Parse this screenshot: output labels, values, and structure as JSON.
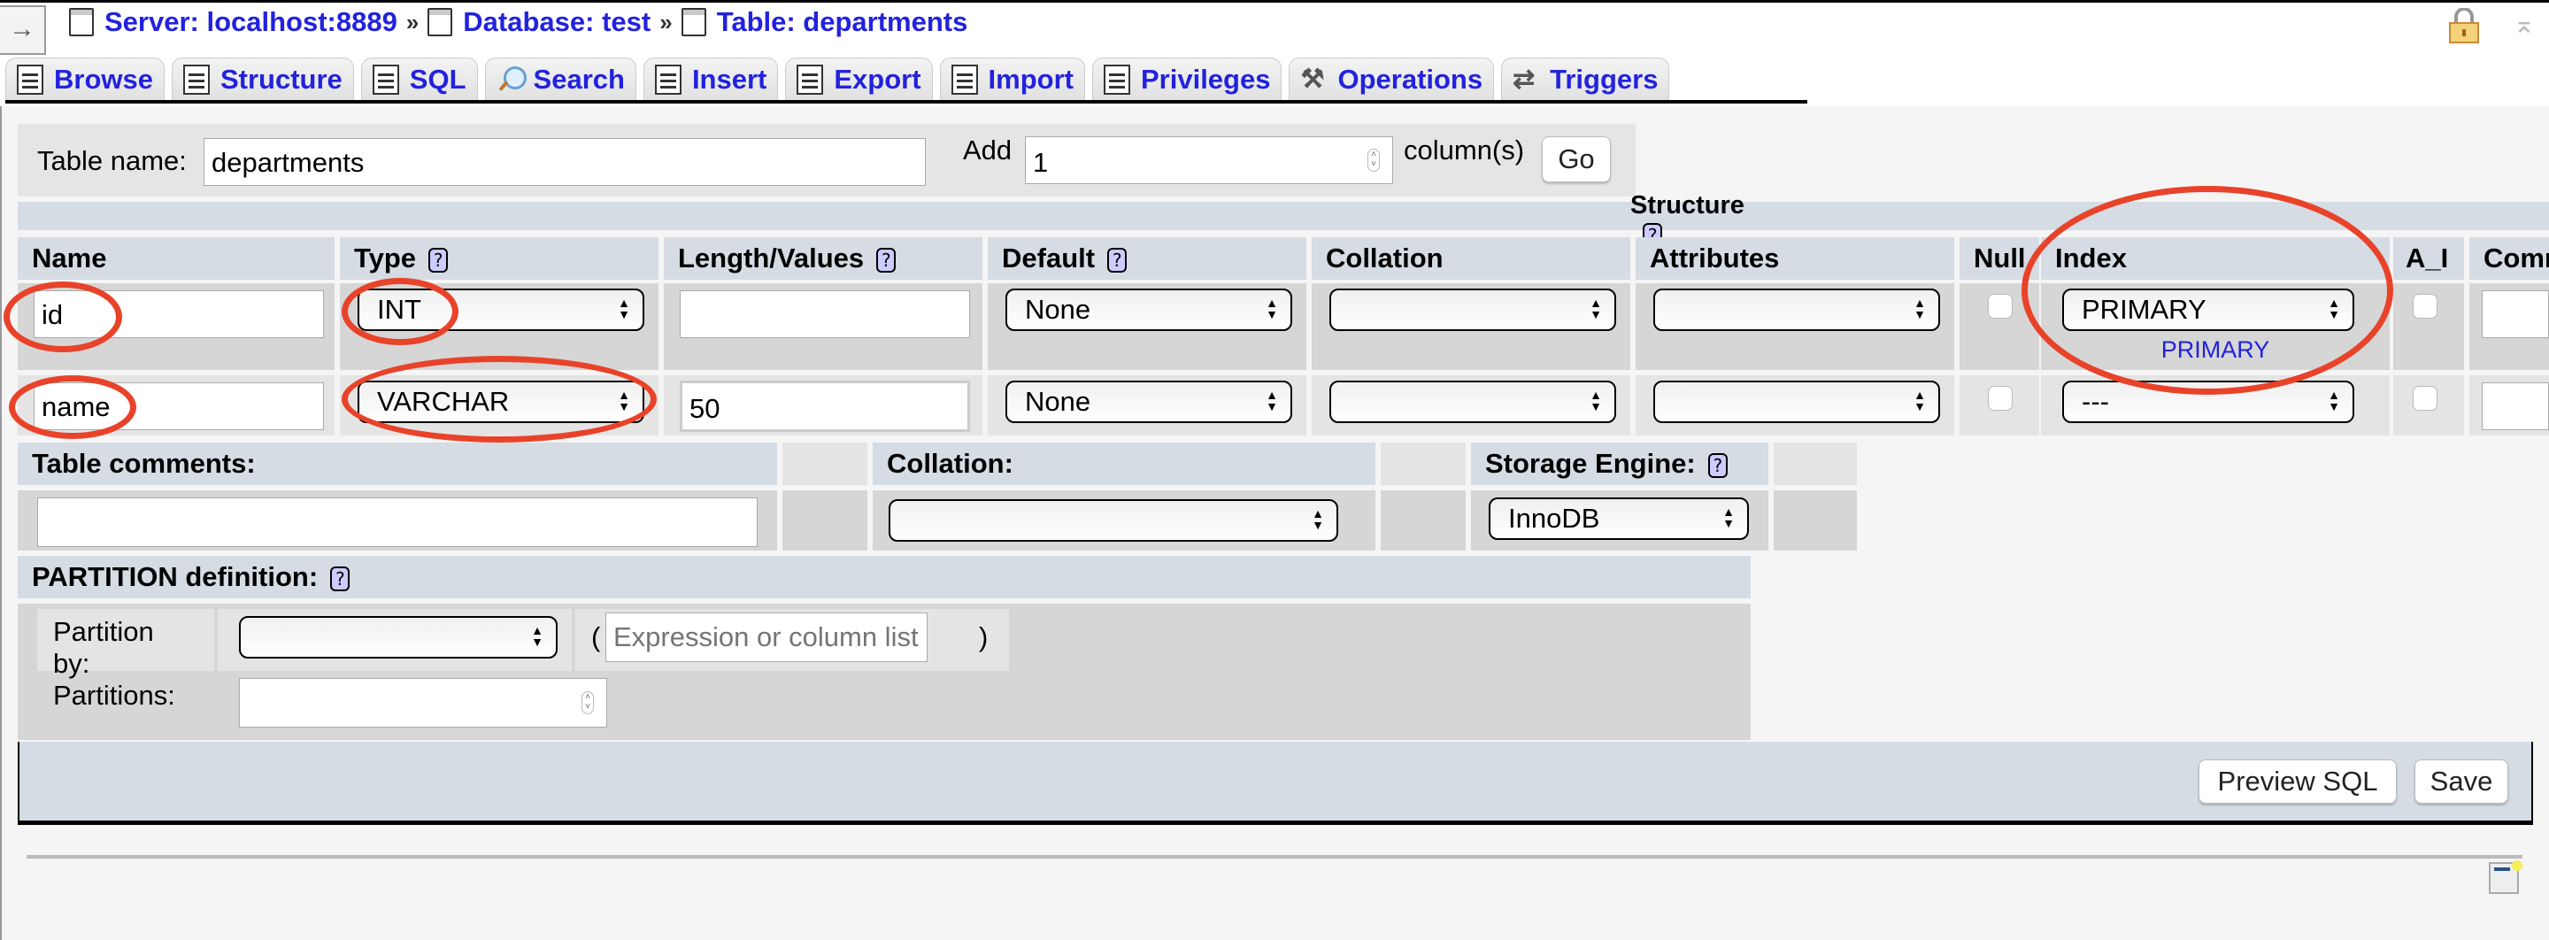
{
  "breadcrumb": {
    "server": "Server: localhost:8889",
    "database": "Database: test",
    "table": "Table: departments",
    "separator": "»"
  },
  "nav_toggle": "→",
  "tabs": [
    {
      "label": "Browse",
      "icon": "browse-icon"
    },
    {
      "label": "Structure",
      "icon": "structure-icon"
    },
    {
      "label": "SQL",
      "icon": "sql-icon"
    },
    {
      "label": "Search",
      "icon": "search-icon"
    },
    {
      "label": "Insert",
      "icon": "insert-icon"
    },
    {
      "label": "Export",
      "icon": "export-icon"
    },
    {
      "label": "Import",
      "icon": "import-icon"
    },
    {
      "label": "Privileges",
      "icon": "privileges-icon"
    },
    {
      "label": "Operations",
      "icon": "operations-icon"
    },
    {
      "label": "Triggers",
      "icon": "triggers-icon"
    }
  ],
  "table_form": {
    "table_name_label": "Table name:",
    "table_name_value": "departments",
    "add_label": "Add",
    "add_value": "1",
    "columns_label": "column(s)",
    "go_label": "Go"
  },
  "structure": {
    "title": "Structure",
    "help": "?",
    "headers": [
      "Name",
      "Type",
      "Length/Values",
      "Default",
      "Collation",
      "Attributes",
      "Null",
      "Index",
      "A_I",
      "Comm"
    ],
    "rows": [
      {
        "name": "id",
        "type": "INT",
        "length": "",
        "default": "None",
        "collation": "",
        "attributes": "",
        "null": false,
        "index": "PRIMARY",
        "index_note": "PRIMARY",
        "ai": false,
        "comment": ""
      },
      {
        "name": "name",
        "type": "VARCHAR",
        "length": "50",
        "default": "None",
        "collation": "",
        "attributes": "",
        "null": false,
        "index": "---",
        "index_note": "",
        "ai": false,
        "comment": ""
      }
    ]
  },
  "table_options": {
    "comments_label": "Table comments:",
    "comments_value": "",
    "collation_label": "Collation:",
    "collation_value": "",
    "engine_label": "Storage Engine:",
    "engine_value": "InnoDB"
  },
  "partition": {
    "title": "PARTITION definition:",
    "partition_by_label": "Partition by:",
    "partition_by_value": "",
    "expression_placeholder": "Expression or column list",
    "open_paren": "(",
    "close_paren": ")",
    "partitions_label": "Partitions:",
    "partitions_value": ""
  },
  "actions": {
    "preview_sql": "Preview SQL",
    "save": "Save"
  },
  "annotation_color": "#e8432a",
  "link_color": "#2222dd"
}
